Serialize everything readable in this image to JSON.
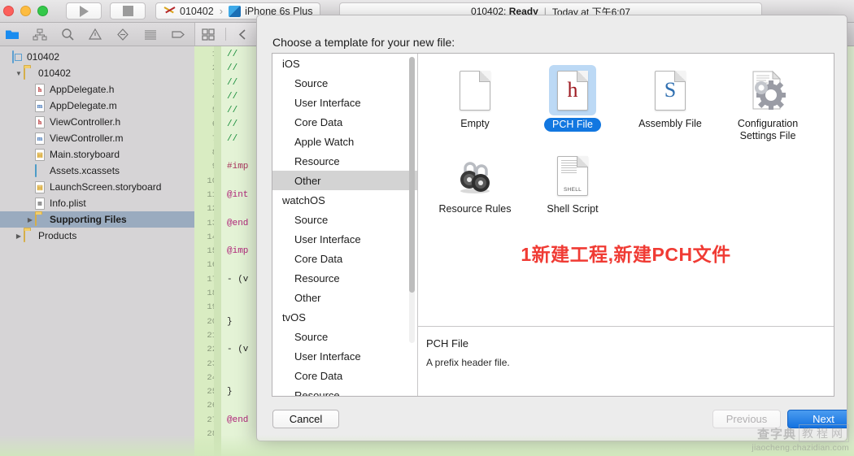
{
  "titlebar": {
    "run_label": "Run",
    "stop_label": "Stop",
    "scheme": "010402",
    "destination": "iPhone 6s Plus",
    "status_target": "010402:",
    "status_state": "Ready",
    "status_time": "Today at 下午6:07"
  },
  "toolbar": {
    "icons": [
      "folder-icon",
      "hierarchy-icon",
      "search-icon",
      "warning-icon",
      "issue-icon",
      "test-icon",
      "tag-icon",
      "comment-icon"
    ],
    "grid_icon": "grid-icon",
    "back_icon": "chevron-left-icon",
    "forward_icon": "chevron-right-icon"
  },
  "navigator": {
    "items": [
      {
        "label": "010402",
        "icon": "project-icon",
        "indent": 0,
        "twisty": "",
        "selected": false
      },
      {
        "label": "010402",
        "icon": "folder-icon",
        "indent": 1,
        "twisty": "▼",
        "selected": false
      },
      {
        "label": "AppDelegate.h",
        "icon": "header-file-icon",
        "indent": 2,
        "twisty": "",
        "selected": false
      },
      {
        "label": "AppDelegate.m",
        "icon": "objc-file-icon",
        "indent": 2,
        "twisty": "",
        "selected": false
      },
      {
        "label": "ViewController.h",
        "icon": "header-file-icon",
        "indent": 2,
        "twisty": "",
        "selected": false
      },
      {
        "label": "ViewController.m",
        "icon": "objc-file-icon",
        "indent": 2,
        "twisty": "",
        "selected": false
      },
      {
        "label": "Main.storyboard",
        "icon": "storyboard-icon",
        "indent": 2,
        "twisty": "",
        "selected": false
      },
      {
        "label": "Assets.xcassets",
        "icon": "assets-icon",
        "indent": 2,
        "twisty": "",
        "selected": false
      },
      {
        "label": "LaunchScreen.storyboard",
        "icon": "storyboard-icon",
        "indent": 2,
        "twisty": "",
        "selected": false
      },
      {
        "label": "Info.plist",
        "icon": "plist-icon",
        "indent": 2,
        "twisty": "",
        "selected": false
      },
      {
        "label": "Supporting Files",
        "icon": "folder-icon",
        "indent": 2,
        "twisty": "▶",
        "selected": true
      },
      {
        "label": "Products",
        "icon": "folder-icon",
        "indent": 1,
        "twisty": "▶",
        "selected": false
      }
    ]
  },
  "editor": {
    "line_numbers": [
      1,
      2,
      3,
      4,
      5,
      6,
      7,
      8,
      9,
      10,
      11,
      12,
      13,
      14,
      15,
      16,
      17,
      18,
      19,
      20,
      21,
      22,
      23,
      24,
      25,
      26,
      27,
      28
    ],
    "lines": [
      {
        "n": 1,
        "text": "//",
        "kind": "comment"
      },
      {
        "n": 2,
        "text": "//",
        "kind": "comment"
      },
      {
        "n": 3,
        "text": "//",
        "kind": "comment"
      },
      {
        "n": 4,
        "text": "//",
        "kind": "comment"
      },
      {
        "n": 5,
        "text": "//",
        "kind": "comment"
      },
      {
        "n": 6,
        "text": "//",
        "kind": "comment"
      },
      {
        "n": 7,
        "text": "//",
        "kind": "comment"
      },
      {
        "n": 8,
        "text": "",
        "kind": "plain"
      },
      {
        "n": 9,
        "text": "#imp",
        "kind": "preproc"
      },
      {
        "n": 10,
        "text": "",
        "kind": "plain"
      },
      {
        "n": 11,
        "text": "@int",
        "kind": "keyword"
      },
      {
        "n": 12,
        "text": "",
        "kind": "plain"
      },
      {
        "n": 13,
        "text": "@end",
        "kind": "keyword"
      },
      {
        "n": 14,
        "text": "",
        "kind": "plain"
      },
      {
        "n": 15,
        "text": "@imp",
        "kind": "keyword"
      },
      {
        "n": 16,
        "text": "",
        "kind": "plain"
      },
      {
        "n": 17,
        "text": "- (v",
        "kind": "plain"
      },
      {
        "n": 18,
        "text": "",
        "kind": "plain"
      },
      {
        "n": 19,
        "text": "",
        "kind": "plain"
      },
      {
        "n": 20,
        "text": "}",
        "kind": "plain"
      },
      {
        "n": 21,
        "text": "",
        "kind": "plain"
      },
      {
        "n": 22,
        "text": "- (v",
        "kind": "plain"
      },
      {
        "n": 23,
        "text": "",
        "kind": "plain"
      },
      {
        "n": 24,
        "text": "",
        "kind": "plain"
      },
      {
        "n": 25,
        "text": "}",
        "kind": "plain"
      },
      {
        "n": 26,
        "text": "",
        "kind": "plain"
      },
      {
        "n": 27,
        "text": "@end",
        "kind": "keyword"
      },
      {
        "n": 28,
        "text": "",
        "kind": "plain"
      }
    ]
  },
  "sheet": {
    "title": "Choose a template for your new file:",
    "categories": [
      {
        "label": "iOS",
        "group": true,
        "selected": false
      },
      {
        "label": "Source",
        "group": false,
        "selected": false
      },
      {
        "label": "User Interface",
        "group": false,
        "selected": false
      },
      {
        "label": "Core Data",
        "group": false,
        "selected": false
      },
      {
        "label": "Apple Watch",
        "group": false,
        "selected": false
      },
      {
        "label": "Resource",
        "group": false,
        "selected": false
      },
      {
        "label": "Other",
        "group": false,
        "selected": true
      },
      {
        "label": "watchOS",
        "group": true,
        "selected": false
      },
      {
        "label": "Source",
        "group": false,
        "selected": false
      },
      {
        "label": "User Interface",
        "group": false,
        "selected": false
      },
      {
        "label": "Core Data",
        "group": false,
        "selected": false
      },
      {
        "label": "Resource",
        "group": false,
        "selected": false
      },
      {
        "label": "Other",
        "group": false,
        "selected": false
      },
      {
        "label": "tvOS",
        "group": true,
        "selected": false
      },
      {
        "label": "Source",
        "group": false,
        "selected": false
      },
      {
        "label": "User Interface",
        "group": false,
        "selected": false
      },
      {
        "label": "Core Data",
        "group": false,
        "selected": false
      },
      {
        "label": "Resource",
        "group": false,
        "selected": false
      }
    ],
    "templates": [
      {
        "label": "Empty",
        "icon": "empty-file-icon",
        "selected": false
      },
      {
        "label": "PCH File",
        "icon": "header-file-icon",
        "selected": true
      },
      {
        "label": "Assembly File",
        "icon": "assembly-file-icon",
        "selected": false
      },
      {
        "label": "Configuration Settings File",
        "icon": "gear-file-icon",
        "selected": false
      },
      {
        "label": "Resource Rules",
        "icon": "padlocks-icon",
        "selected": false
      },
      {
        "label": "Shell Script",
        "icon": "shell-script-file-icon",
        "selected": false
      }
    ],
    "annotation": "1新建工程,新建PCH文件",
    "annotation_color": "#f03b34",
    "description_title": "PCH File",
    "description_body": "A prefix header file.",
    "cancel_label": "Cancel",
    "previous_label": "Previous",
    "next_label": "Next",
    "next_color": "#1472e0"
  },
  "watermark": {
    "logo_a": "查字典",
    "logo_b": "教程网",
    "url": "jiaocheng.chazidian.com"
  }
}
